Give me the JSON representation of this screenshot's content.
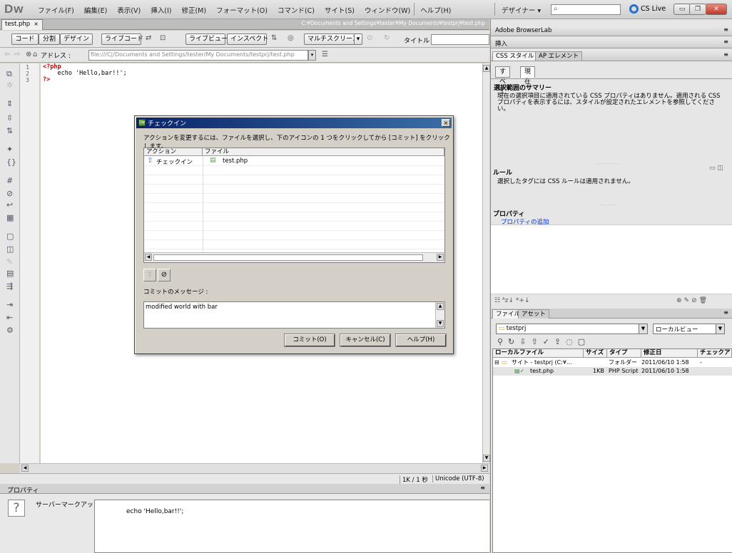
{
  "app": {
    "logo": "Dw",
    "menus": [
      "ファイル(F)",
      "編集(E)",
      "表示(V)",
      "挿入(I)",
      "修正(M)",
      "フォーマット(O)",
      "コマンド(C)",
      "サイト(S)",
      "ウィンドウ(W)",
      "ヘルプ(H)"
    ],
    "workspace": "デザイナー ▾",
    "search_placeholder": "",
    "cslive": "CS Live"
  },
  "document": {
    "tab_label": "test.php",
    "tab_close": "×",
    "path": "C:¥Documents and Settings¥tester¥My Documents¥testprj¥test.php",
    "view_buttons": {
      "code": "コード",
      "split": "分割",
      "design": "デザイン",
      "live_code": "ライブコード",
      "live_view": "ライブビュー",
      "inspect": "インスペクト",
      "multiscreen": "マルチスクリーン"
    },
    "title_label": "タイトル :",
    "address_label": "アドレス :",
    "address_value": "file:///C|/Documents and Settings/tester/My Documents/testprj/test.php",
    "code_lines": [
      {
        "num": "1",
        "text": "<?php"
      },
      {
        "num": "2",
        "text": "    echo 'Hello,bar!!';"
      },
      {
        "num": "3",
        "text": "?>"
      }
    ],
    "status_size": "1K / 1 秒",
    "status_encoding": "Unicode (UTF-8)"
  },
  "properties_panel": {
    "title": "プロパティ",
    "label": "サーバーマークアップ",
    "code": "echo 'Hello,bar!!';"
  },
  "right_panels": {
    "browserlab": "Adobe BrowserLab",
    "insert": "挿入",
    "css_tab": "CSS スタイル",
    "ap_tab": "AP エレメント",
    "subtab_all": "すべて",
    "subtab_current": "現在",
    "summary_head": "選択範囲のサマリー",
    "summary_text": "現在の選択項目に適用されている CSS プロパティはありません。適用される CSS プロパティを表示するには、スタイルが設定されたエレメントを参照してください。",
    "rules_head": "ルール",
    "rules_text": "選択したタグには CSS ルールは適用されません。",
    "props_head": "プロパティ",
    "props_add": "プロパティの追加",
    "files_tab": "ファイル",
    "assets_tab": "アセット",
    "site_select": "testprj",
    "view_select": "ローカルビュー",
    "columns": [
      "ローカルファイル",
      "サイズ",
      "タイプ",
      "修正日",
      "チェックア"
    ],
    "rows": [
      {
        "name": "サイト - testprj (C:¥...",
        "size": "",
        "type": "フォルダー",
        "modified": "2011/06/10 1:58",
        "checked": "-"
      },
      {
        "name": "test.php",
        "size": "1KB",
        "type": "PHP Script",
        "modified": "2011/06/10 1:58",
        "checked": ""
      }
    ]
  },
  "dialog": {
    "title": "チェックイン",
    "close": "×",
    "instruction": "アクションを変更するには、ファイルを選択し、下のアイコンの 1 つをクリックしてから [コミット] をクリックします。",
    "col_action": "アクション",
    "col_file": "ファイル",
    "rows": [
      {
        "action": "チェックイン",
        "file": "test.php"
      }
    ],
    "commit_msg_label": "コミットのメッセージ :",
    "commit_msg": "modified world with bar",
    "commit_btn": "コミット(O)",
    "cancel_btn": "キャンセル(C)",
    "help_btn": "ヘルプ(H)"
  }
}
